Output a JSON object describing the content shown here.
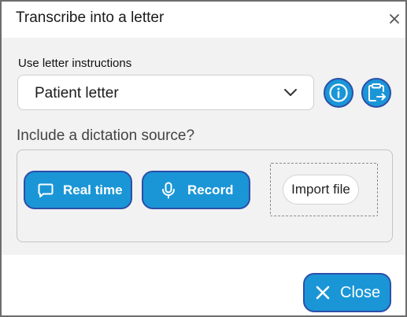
{
  "dialog": {
    "title": "Transcribe into a letter",
    "close_icon": "close-icon"
  },
  "instructions": {
    "label": "Use letter instructions",
    "selected": "Patient letter",
    "dropdown_icon": "chevron-down-icon",
    "info_icon": "info-icon",
    "clipboard_icon": "clipboard-export-icon"
  },
  "dictation": {
    "label": "Include a dictation source?",
    "realtime_label": "Real time",
    "realtime_icon": "speech-bubble-icon",
    "record_label": "Record",
    "record_icon": "microphone-icon",
    "import_label": "Import file"
  },
  "footer": {
    "close_label": "Close",
    "close_icon": "x-icon"
  },
  "colors": {
    "accent": "#1a96d7",
    "accent_border": "#2c4ea8",
    "panel_bg": "#f2f2f2"
  }
}
